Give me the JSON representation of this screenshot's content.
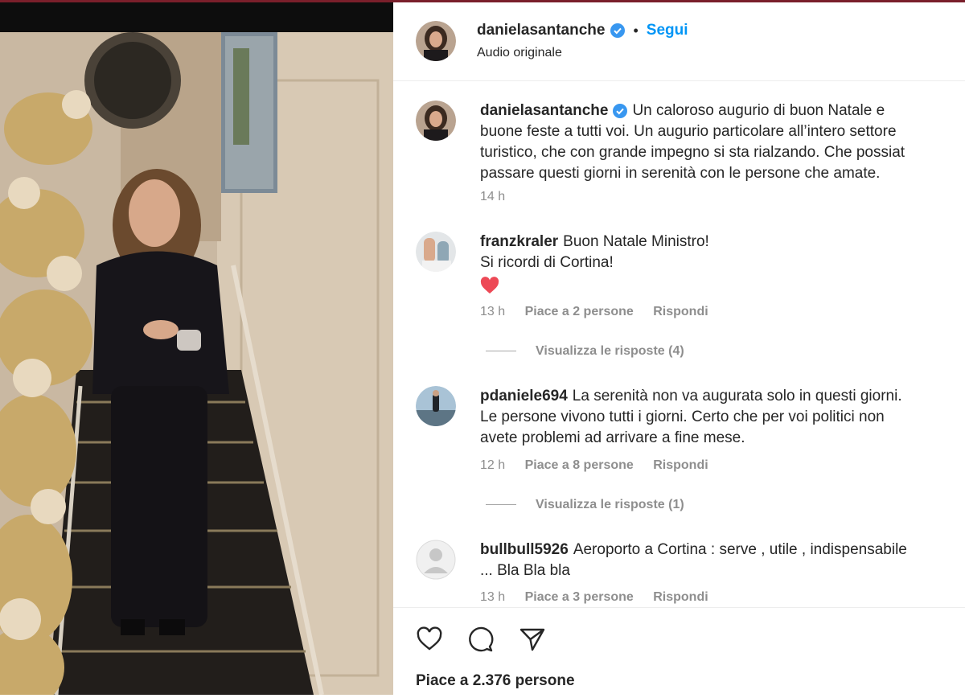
{
  "post": {
    "username": "danielasantanche",
    "follow_label": "Segui",
    "separator": "•",
    "audio": "Audio originale",
    "likes": "Piace a 2.376 persone"
  },
  "caption": {
    "username": "danielasantanche",
    "lines": [
      "Un caloroso augurio di buon Natale e",
      "buone feste a tutti voi. Un augurio particolare all’intero settore",
      "turistico, che con grande impegno si sta rialzando. Che possiat",
      "passare questi giorni in serenità con le persone che amate."
    ],
    "time": "14 h"
  },
  "comments": [
    {
      "username": "franzkraler",
      "lines": [
        "Buon Natale Ministro!",
        "Si ricordi di Cortina!"
      ],
      "emoji": "heart",
      "time": "13 h",
      "likes": "Piace a 2 persone",
      "reply": "Rispondi",
      "view_replies": "Visualizza le risposte (4)"
    },
    {
      "username": "pdaniele694",
      "lines": [
        "La serenità non va augurata solo in questi giorni.",
        "Le persone vivono tutti i giorni. Certo che per voi politici non",
        "avete problemi ad arrivare a fine mese."
      ],
      "time": "12 h",
      "likes": "Piace a 8 persone",
      "reply": "Rispondi",
      "view_replies": "Visualizza le risposte (1)"
    },
    {
      "username": "bullbull5926",
      "lines": [
        "Aeroporto a Cortina : serve , utile , indispensabile",
        "... Bla Bla bla"
      ],
      "time": "13 h",
      "likes": "Piace a 3 persone",
      "reply": "Rispondi"
    }
  ],
  "icons": {
    "verified": "verified-badge-icon",
    "like": "heart-icon",
    "comment": "comment-icon",
    "share": "paper-plane-icon"
  },
  "colors": {
    "link": "#0095f6",
    "verified": "#3897f0",
    "heart": "#ed4956",
    "muted": "#8e8e8e"
  }
}
